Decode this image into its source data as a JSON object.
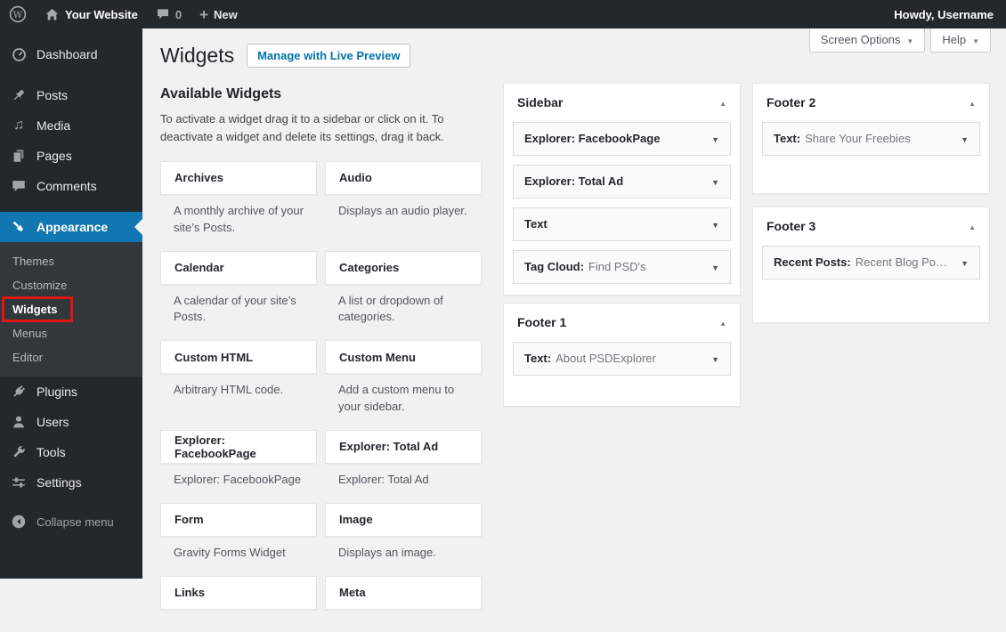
{
  "admin_bar": {
    "site_name": "Your Website",
    "comments_count": "0",
    "new_label": "New",
    "howdy": "Howdy, Username"
  },
  "tabs": {
    "screen_options_label": "Screen Options",
    "help_label": "Help"
  },
  "nav": {
    "items": [
      {
        "label": "Dashboard",
        "icon": "dashboard-icon"
      },
      {
        "label": "Posts",
        "icon": "pushpin-icon"
      },
      {
        "label": "Media",
        "icon": "media-icon"
      },
      {
        "label": "Pages",
        "icon": "pages-icon"
      },
      {
        "label": "Comments",
        "icon": "comments-icon"
      },
      {
        "label": "Appearance",
        "icon": "appearance-brush-icon",
        "active": true
      },
      {
        "label": "Plugins",
        "icon": "plugin-icon"
      },
      {
        "label": "Users",
        "icon": "user-icon"
      },
      {
        "label": "Tools",
        "icon": "wrench-icon"
      },
      {
        "label": "Settings",
        "icon": "settings-sliders-icon"
      }
    ],
    "appearance_submenu": {
      "items": [
        "Themes",
        "Customize",
        "Widgets",
        "Menus",
        "Editor"
      ],
      "highlighted": "Widgets"
    },
    "collapse_label": "Collapse menu"
  },
  "page": {
    "title": "Widgets",
    "manage_button": "Manage with Live Preview",
    "available": {
      "heading": "Available Widgets",
      "description": "To activate a widget drag it to a sidebar or click on it. To deactivate a widget and delete its settings, drag it back.",
      "widgets": [
        {
          "title": "Archives",
          "description": "A monthly archive of your site’s Posts."
        },
        {
          "title": "Audio",
          "description": "Displays an audio player."
        },
        {
          "title": "Calendar",
          "description": "A calendar of your site’s Posts."
        },
        {
          "title": "Categories",
          "description": "A list or dropdown of categories."
        },
        {
          "title": "Custom HTML",
          "description": "Arbitrary HTML code."
        },
        {
          "title": "Custom Menu",
          "description": "Add a custom menu to your sidebar."
        },
        {
          "title": "Explorer: FacebookPage",
          "description": "Explorer: FacebookPage"
        },
        {
          "title": "Explorer: Total Ad",
          "description": "Explorer: Total Ad"
        },
        {
          "title": "Form",
          "description": "Gravity Forms Widget"
        },
        {
          "title": "Image",
          "description": "Displays an image."
        },
        {
          "title": "Links",
          "description": ""
        },
        {
          "title": "Meta",
          "description": ""
        }
      ]
    },
    "areas": [
      {
        "title": "Sidebar",
        "widgets": [
          {
            "name": "Explorer: FacebookPage",
            "detail": ""
          },
          {
            "name": "Explorer: Total Ad",
            "detail": ""
          },
          {
            "name": "Text",
            "detail": ""
          },
          {
            "name": "Tag Cloud:",
            "detail": "Find PSD's"
          }
        ]
      },
      {
        "title": "Footer 1",
        "widgets": [
          {
            "name": "Text:",
            "detail": "About PSDExplorer"
          }
        ]
      },
      {
        "title": "Footer 2",
        "widgets": [
          {
            "name": "Text:",
            "detail": "Share Your Freebies"
          }
        ]
      },
      {
        "title": "Footer 3",
        "widgets": [
          {
            "name": "Recent Posts:",
            "detail": "Recent Blog Po…"
          }
        ]
      }
    ]
  },
  "colors": {
    "admin_bar_bg": "#23282d",
    "submenu_bg": "#32373c",
    "active_item_blue": "#1277b1",
    "link_blue": "#0073aa",
    "content_bg": "#f1f1f1",
    "annotation_red": "#df1612",
    "card_border": "#e5e5e5"
  }
}
